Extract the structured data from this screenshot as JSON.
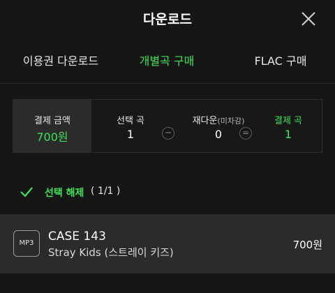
{
  "header": {
    "title": "다운로드",
    "close_icon": "close-icon"
  },
  "tabs": [
    {
      "label": "이용권 다운로드",
      "active": false
    },
    {
      "label": "개별곡 구매",
      "active": true
    },
    {
      "label": "FLAC 구매",
      "active": false
    }
  ],
  "summary": {
    "payment_amount_label": "결제 금액",
    "payment_amount_value": "700원",
    "selected_label": "선택 곡",
    "selected_value": "1",
    "redownload_label": "재다운",
    "redownload_sub": "(미차감)",
    "redownload_value": "0",
    "payment_songs_label": "결제 곡",
    "payment_songs_value": "1",
    "minus_symbol": "−",
    "equals_symbol": "="
  },
  "select_bar": {
    "label": "선택 해제",
    "count": "( 1/1 )",
    "icon": "check-icon"
  },
  "songs": [
    {
      "format": "MP3",
      "title": "CASE 143",
      "artist": "Stray Kids (스트레이 키즈)",
      "price": "700원"
    }
  ],
  "colors": {
    "accent": "#3ee35a",
    "background": "#161616",
    "panel": "#2b2b2b"
  }
}
